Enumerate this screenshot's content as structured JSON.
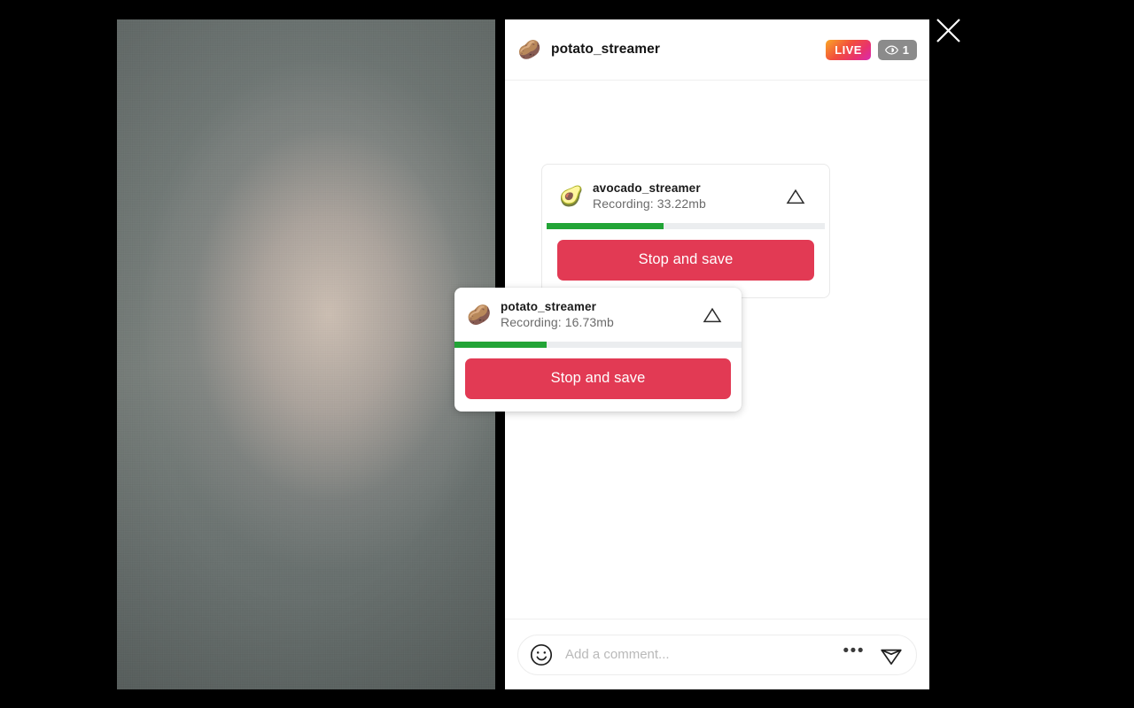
{
  "window": {
    "background_color": "#000000",
    "close_label": "close-icon"
  },
  "video": {
    "name": "live-video-feed",
    "description": "blurred gray wall camera feed"
  },
  "sidebar": {
    "header": {
      "avatar_emoji": "🥔",
      "username": "potato_streamer",
      "live_badge": "LIVE",
      "viewer_count": "1",
      "live_gradient_from": "#f9a826",
      "live_gradient_to": "#d92bb0",
      "viewer_badge_color": "#8b8b8b"
    },
    "recordings": [
      {
        "avatar_emoji": "🥑",
        "username": "avocado_streamer",
        "status": "Recording: 33.22mb",
        "progress_percent": 42,
        "progress_color": "#22a436",
        "warning_icon": "warning-triangle-icon",
        "button_label": "Stop and save",
        "button_color": "#e23a54"
      },
      {
        "avatar_emoji": "🥔",
        "username": "potato_streamer",
        "status": "Recording: 16.73mb",
        "progress_percent": 32,
        "progress_color": "#22a436",
        "warning_icon": "warning-triangle-icon",
        "button_label": "Stop and save",
        "button_color": "#e23a54"
      }
    ],
    "comment_bar": {
      "emoji_icon": "smiley-face-icon",
      "placeholder": "Add a comment...",
      "value": "",
      "more_label": "•••",
      "send_icon": "send-paper-plane-icon"
    }
  }
}
